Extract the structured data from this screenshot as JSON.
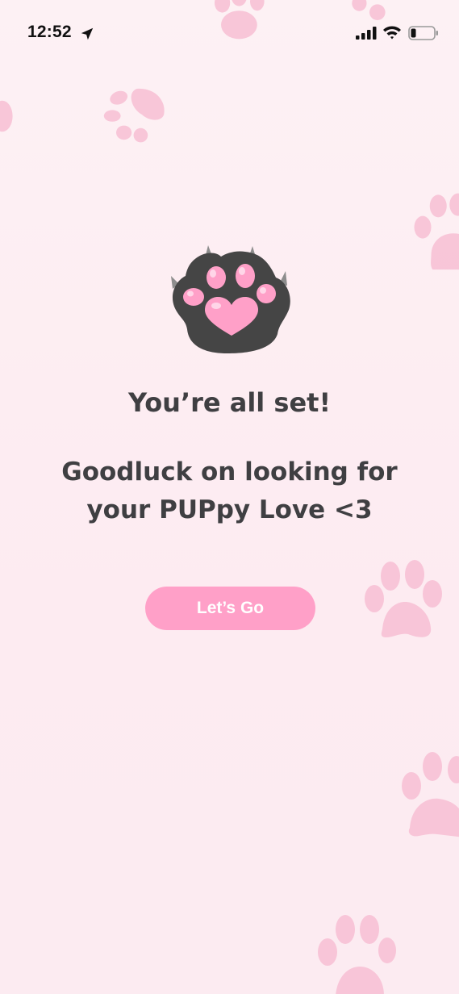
{
  "status_bar": {
    "time": "12:52",
    "location_icon": "location-arrow-icon",
    "signal_icon": "cellular-signal-icon",
    "wifi_icon": "wifi-icon",
    "battery_icon": "battery-icon"
  },
  "main": {
    "logo_icon": "paw-heart-icon",
    "title": "You’re all set!",
    "message": "Goodluck on looking for your PUPpy Love <3",
    "button_label": "Let’s Go"
  },
  "colors": {
    "background": "#fdf1f4",
    "background_paws": "#f8bfd4",
    "text": "#3f3f42",
    "button": "#ffa0c8",
    "button_text": "#ffffff",
    "logo_paw": "#454545",
    "logo_pads": "#ffa0c8"
  }
}
